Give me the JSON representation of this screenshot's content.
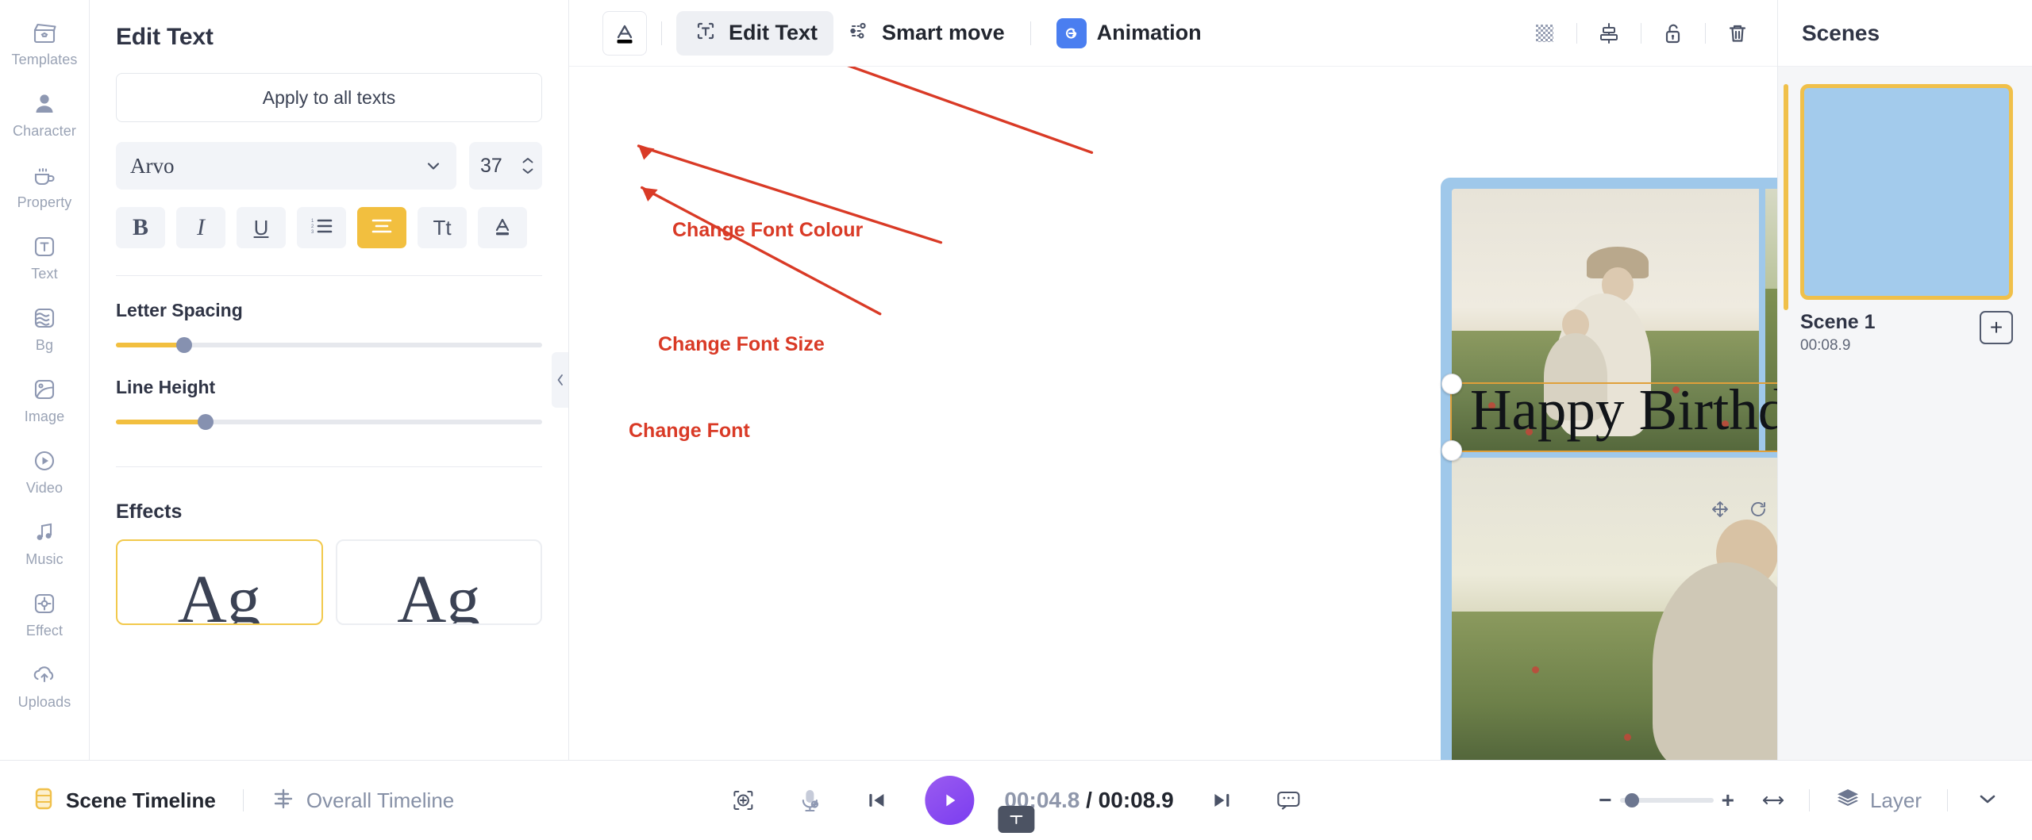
{
  "rail": {
    "items": [
      {
        "label": "Templates",
        "icon": "templates-icon"
      },
      {
        "label": "Character",
        "icon": "character-icon"
      },
      {
        "label": "Property",
        "icon": "property-icon"
      },
      {
        "label": "Text",
        "icon": "text-icon"
      },
      {
        "label": "Bg",
        "icon": "bg-icon"
      },
      {
        "label": "Image",
        "icon": "image-icon"
      },
      {
        "label": "Video",
        "icon": "video-icon"
      },
      {
        "label": "Music",
        "icon": "music-icon"
      },
      {
        "label": "Effect",
        "icon": "effect-icon"
      },
      {
        "label": "Uploads",
        "icon": "uploads-icon"
      }
    ]
  },
  "panel": {
    "title": "Edit Text",
    "apply_label": "Apply to all texts",
    "font_name": "Arvo",
    "font_size": "37",
    "format_buttons": [
      {
        "name": "bold",
        "glyph": "B"
      },
      {
        "name": "italic",
        "glyph": "I"
      },
      {
        "name": "underline",
        "glyph": "U"
      },
      {
        "name": "list",
        "glyph": "list"
      },
      {
        "name": "align",
        "glyph": "align"
      },
      {
        "name": "text-case",
        "glyph": "Tt"
      },
      {
        "name": "font-color",
        "glyph": "A"
      }
    ],
    "letter_spacing_label": "Letter Spacing",
    "letter_spacing_percent": 16,
    "line_height_label": "Line Height",
    "line_height_percent": 21,
    "effects_label": "Effects",
    "effects": [
      {
        "label": "Ag",
        "selected": true
      },
      {
        "label": "Ag",
        "selected": false
      }
    ]
  },
  "toolbar": {
    "font_color_icon": "font-colour-icon",
    "font_color_swatch": "#000000",
    "edit_text": "Edit Text",
    "smart_move": "Smart move",
    "animation": "Animation",
    "right_icons": [
      {
        "name": "transparency-icon"
      },
      {
        "name": "align-icon"
      },
      {
        "name": "unlock-icon"
      },
      {
        "name": "trash-icon"
      }
    ]
  },
  "canvas": {
    "headline": "Happy Birthday Zia!",
    "heart": "❤",
    "artboard_bg": "#9fc8ea",
    "selection_color": "#e0a03a"
  },
  "annotations": [
    {
      "text": "Change Font Colour"
    },
    {
      "text": "Change Font Size"
    },
    {
      "text": "Change Font"
    }
  ],
  "scenes": {
    "title": "Scenes",
    "items": [
      {
        "name": "Scene 1",
        "duration": "00:08.9"
      }
    ],
    "add_label": "+"
  },
  "bottom": {
    "scene_timeline": "Scene Timeline",
    "overall_timeline": "Overall Timeline",
    "current_time": "00:04.8",
    "separator": "/",
    "total_time": "00:08.9",
    "zoom_minus": "−",
    "zoom_plus": "+",
    "zoom_percent": 8,
    "layer_label": "Layer"
  }
}
